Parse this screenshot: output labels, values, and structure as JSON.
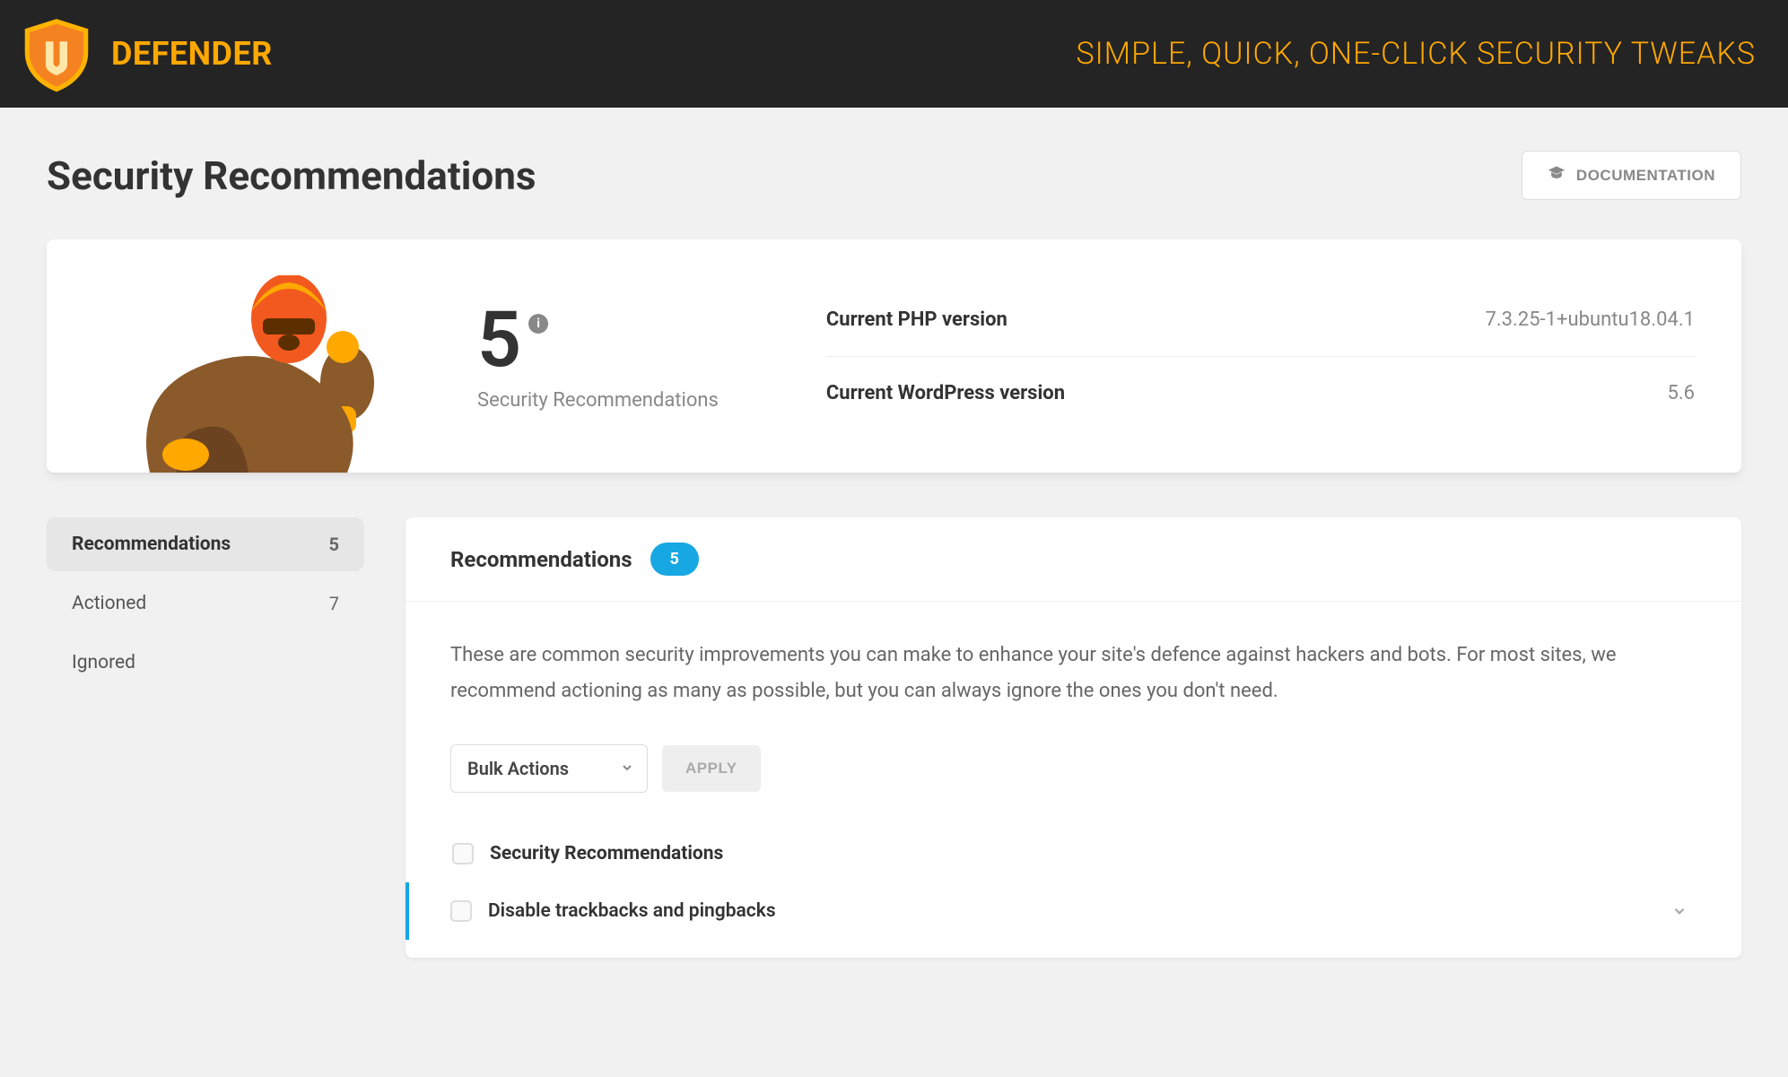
{
  "header": {
    "brand": "DEFENDER",
    "tagline": "SIMPLE, QUICK, ONE-CLICK SECURITY TWEAKS"
  },
  "page": {
    "title": "Security Recommendations",
    "documentation_label": "DOCUMENTATION"
  },
  "summary": {
    "count": "5",
    "count_label": "Security Recommendations",
    "stats": [
      {
        "label": "Current PHP version",
        "value": "7.3.25-1+ubuntu18.04.1"
      },
      {
        "label": "Current WordPress version",
        "value": "5.6"
      }
    ]
  },
  "sidebar": {
    "items": [
      {
        "label": "Recommendations",
        "count": "5",
        "active": true
      },
      {
        "label": "Actioned",
        "count": "7",
        "active": false
      },
      {
        "label": "Ignored",
        "count": "",
        "active": false
      }
    ]
  },
  "panel": {
    "title": "Recommendations",
    "badge": "5",
    "description": "These are common security improvements you can make to enhance your site's defence against hackers and bots. For most sites, we recommend actioning as many as possible, but you can always ignore the ones you don't need.",
    "bulk_select_label": "Bulk Actions",
    "apply_label": "APPLY",
    "list_header": "Security Recommendations",
    "items": [
      {
        "label": "Disable trackbacks and pingbacks"
      }
    ]
  }
}
